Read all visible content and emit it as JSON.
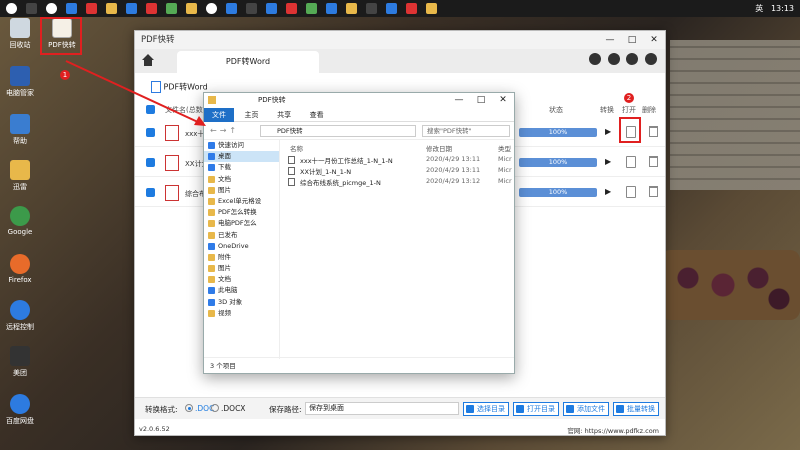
{
  "desktop": {
    "icons": [
      "回收站",
      "电脑管家",
      "PDF快转",
      "帮助",
      "迅雷",
      "Google",
      "Firefox",
      "远程控制",
      "美团",
      "百度网盘"
    ],
    "pdf_shortcut_label": "PDF快转",
    "badge1": "1",
    "badge2": "2"
  },
  "taskbar": {
    "time": "13:13",
    "ime": "英"
  },
  "app": {
    "title": "PDF快转",
    "tab_label": "PDF转Word",
    "section_title": "PDF转Word",
    "columns": {
      "name": "文件名(总数)",
      "status": "状态",
      "convert": "转换",
      "open": "打开",
      "delete": "删除"
    },
    "rows": [
      {
        "name": "xxx十一月份工作总结",
        "progress": "100%"
      },
      {
        "name": "XX计划",
        "progress": "100%"
      },
      {
        "name": "综合布线系统",
        "progress": "100%"
      }
    ],
    "bottom": {
      "format_label": "转换格式:",
      "opt_doc": ".DOC",
      "opt_docx": ".DOCX",
      "path_label": "保存路径:",
      "path_value": "保存到桌面",
      "btn_select_dir": "选择目录",
      "btn_open_dir": "打开目录",
      "btn_add_file": "添加文件",
      "btn_batch": "批量转换"
    },
    "footer": {
      "version": "v2.0.6.52",
      "site": "官网: https://www.pdfkz.com"
    }
  },
  "explorer": {
    "title": "PDF快转",
    "ribbon": [
      "文件",
      "主页",
      "共享",
      "查看"
    ],
    "address": "PDF快转",
    "search_placeholder": "搜索\"PDF快转\"",
    "nav": [
      {
        "label": "快速访问",
        "kind": "blue"
      },
      {
        "label": "桌面",
        "kind": "blue"
      },
      {
        "label": "下载",
        "kind": "blue"
      },
      {
        "label": "文档",
        "kind": "folder"
      },
      {
        "label": "图片",
        "kind": "folder"
      },
      {
        "label": "Excel单元格设",
        "kind": "folder"
      },
      {
        "label": "PDF怎么转换",
        "kind": "folder"
      },
      {
        "label": "电脑PDF怎么",
        "kind": "folder"
      },
      {
        "label": "已发布",
        "kind": "folder"
      },
      {
        "label": "OneDrive",
        "kind": "blue"
      },
      {
        "label": "附件",
        "kind": "folder"
      },
      {
        "label": "图片",
        "kind": "folder"
      },
      {
        "label": "文档",
        "kind": "folder"
      },
      {
        "label": "此电脑",
        "kind": "blue"
      },
      {
        "label": "3D 对象",
        "kind": "blue"
      },
      {
        "label": "视频",
        "kind": "folder"
      }
    ],
    "headers": {
      "name": "名称",
      "date": "修改日期",
      "type": "类型"
    },
    "files": [
      {
        "name": "xxx十一月份工作总结_1-N_1-N",
        "date": "2020/4/29 13:11",
        "type": "Micr"
      },
      {
        "name": "XX计划_1-N_1-N",
        "date": "2020/4/29 13:11",
        "type": "Micr"
      },
      {
        "name": "综合布线系统_picmge_1-N",
        "date": "2020/4/29 13:12",
        "type": "Micr"
      }
    ],
    "status": "3 个项目"
  }
}
